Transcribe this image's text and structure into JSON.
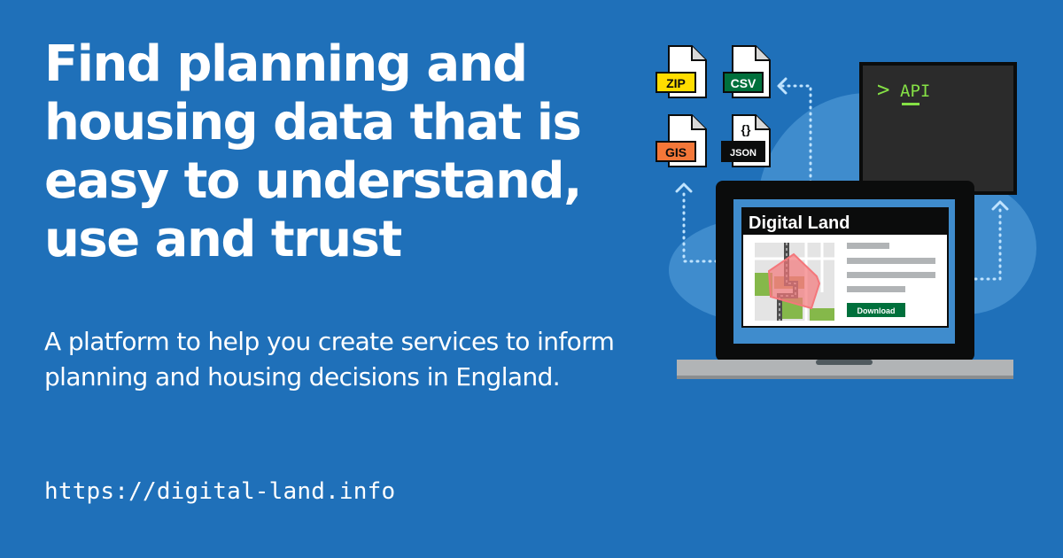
{
  "headline": "Find planning and housing data that is easy to understand, use and trust",
  "subheading": "A platform to help you create services to inform planning and housing decisions in England.",
  "url": "https://digital-land.info",
  "illustration": {
    "file_icons": [
      {
        "label": "ZIP",
        "badge_color": "#ffdd00",
        "text_color": "#0b0c0c"
      },
      {
        "label": "CSV",
        "badge_color": "#00703c",
        "text_color": "#ffffff"
      },
      {
        "label": "GIS",
        "badge_color": "#f47738",
        "text_color": "#0b0c0c"
      },
      {
        "label": "JSON",
        "badge_color": "#0b0c0c",
        "text_color": "#ffffff",
        "glyph": "{}"
      }
    ],
    "terminal": {
      "prompt": ">",
      "command": "API",
      "accent_color": "#85e045"
    },
    "laptop_screen": {
      "title": "Digital Land",
      "download_label": "Download",
      "download_color": "#00703c"
    }
  },
  "colors": {
    "background": "#1f70b9",
    "text": "#ffffff",
    "cloud": "#3f8ccd",
    "dotted_arrows": "#bfe3ff"
  }
}
